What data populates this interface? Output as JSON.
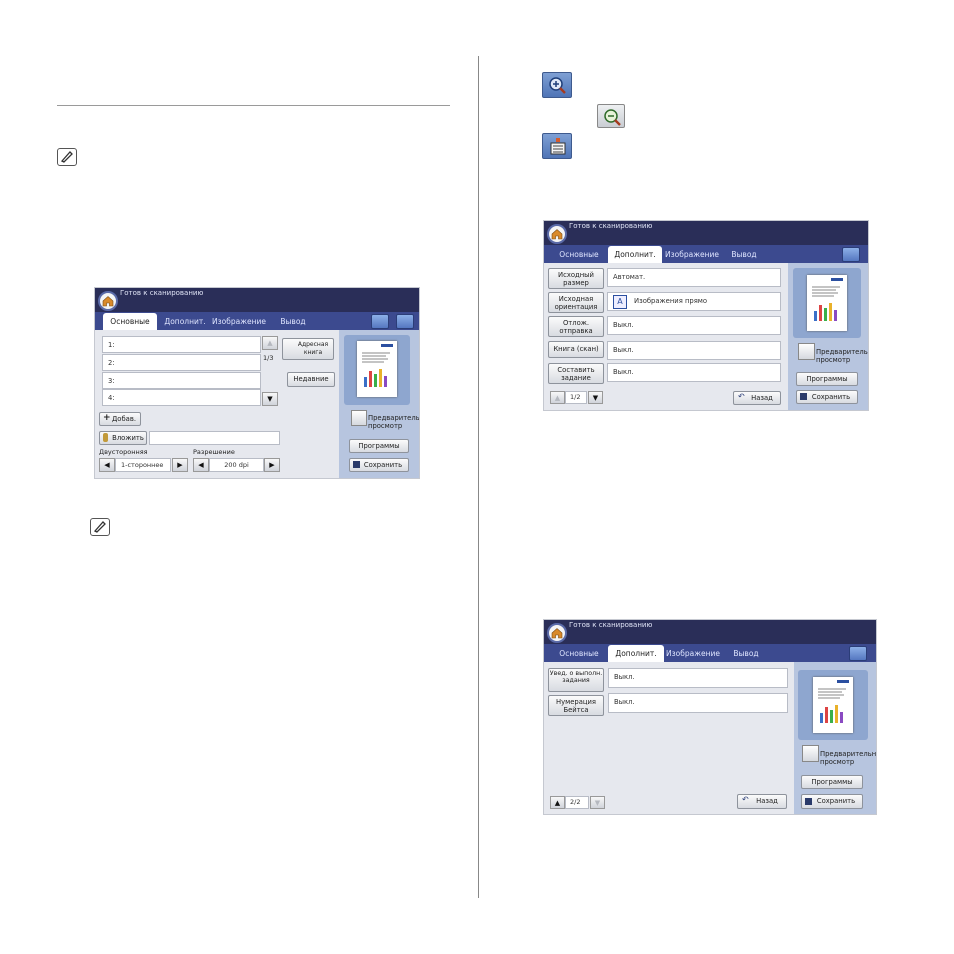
{
  "panel1": {
    "status": "Готов к сканированию",
    "tabs": [
      "Основные",
      "Дополнит.",
      "Изображение",
      "Вывод"
    ],
    "list_items": [
      "1:",
      "2:",
      "3:",
      "4:"
    ],
    "page_counter": "1/3",
    "address_book": "Адресная книга",
    "recent": "Недавние",
    "add": "Добав.",
    "attach": "Вложить",
    "duplex_label": "Двусторонняя",
    "duplex_value": "1-стороннее",
    "resolution_label": "Разрешение",
    "resolution_value": "200 dpi",
    "preview": "Предварительный просмотр",
    "programs": "Программы",
    "save": "Сохранить"
  },
  "panel2": {
    "status": "Готов к сканированию",
    "tabs": [
      "Основные",
      "Дополнит.",
      "Изображение",
      "Вывод"
    ],
    "rows": [
      {
        "label": "Исходный размер",
        "value": "Автомат."
      },
      {
        "label": "Исходная ориентация",
        "value": "Изображения прямо"
      },
      {
        "label": "Отлож. отправка",
        "value": "Выкл."
      },
      {
        "label": "Книга (скан)",
        "value": "Выкл."
      },
      {
        "label": "Составить задание",
        "value": "Выкл."
      }
    ],
    "page_counter": "1/2",
    "back": "Назад",
    "preview": "Предварительный просмотр",
    "programs": "Программы",
    "save": "Сохранить"
  },
  "panel3": {
    "status": "Готов к сканированию",
    "tabs": [
      "Основные",
      "Дополнит.",
      "Изображение",
      "Вывод"
    ],
    "rows": [
      {
        "label": "Увед. о выполн. задания",
        "value": "Выкл."
      },
      {
        "label": "Нумерация Бейтса",
        "value": "Выкл."
      }
    ],
    "page_counter": "2/2",
    "back": "Назад",
    "preview": "Предварительный просмотр",
    "programs": "Программы",
    "save": "Сохранить"
  }
}
